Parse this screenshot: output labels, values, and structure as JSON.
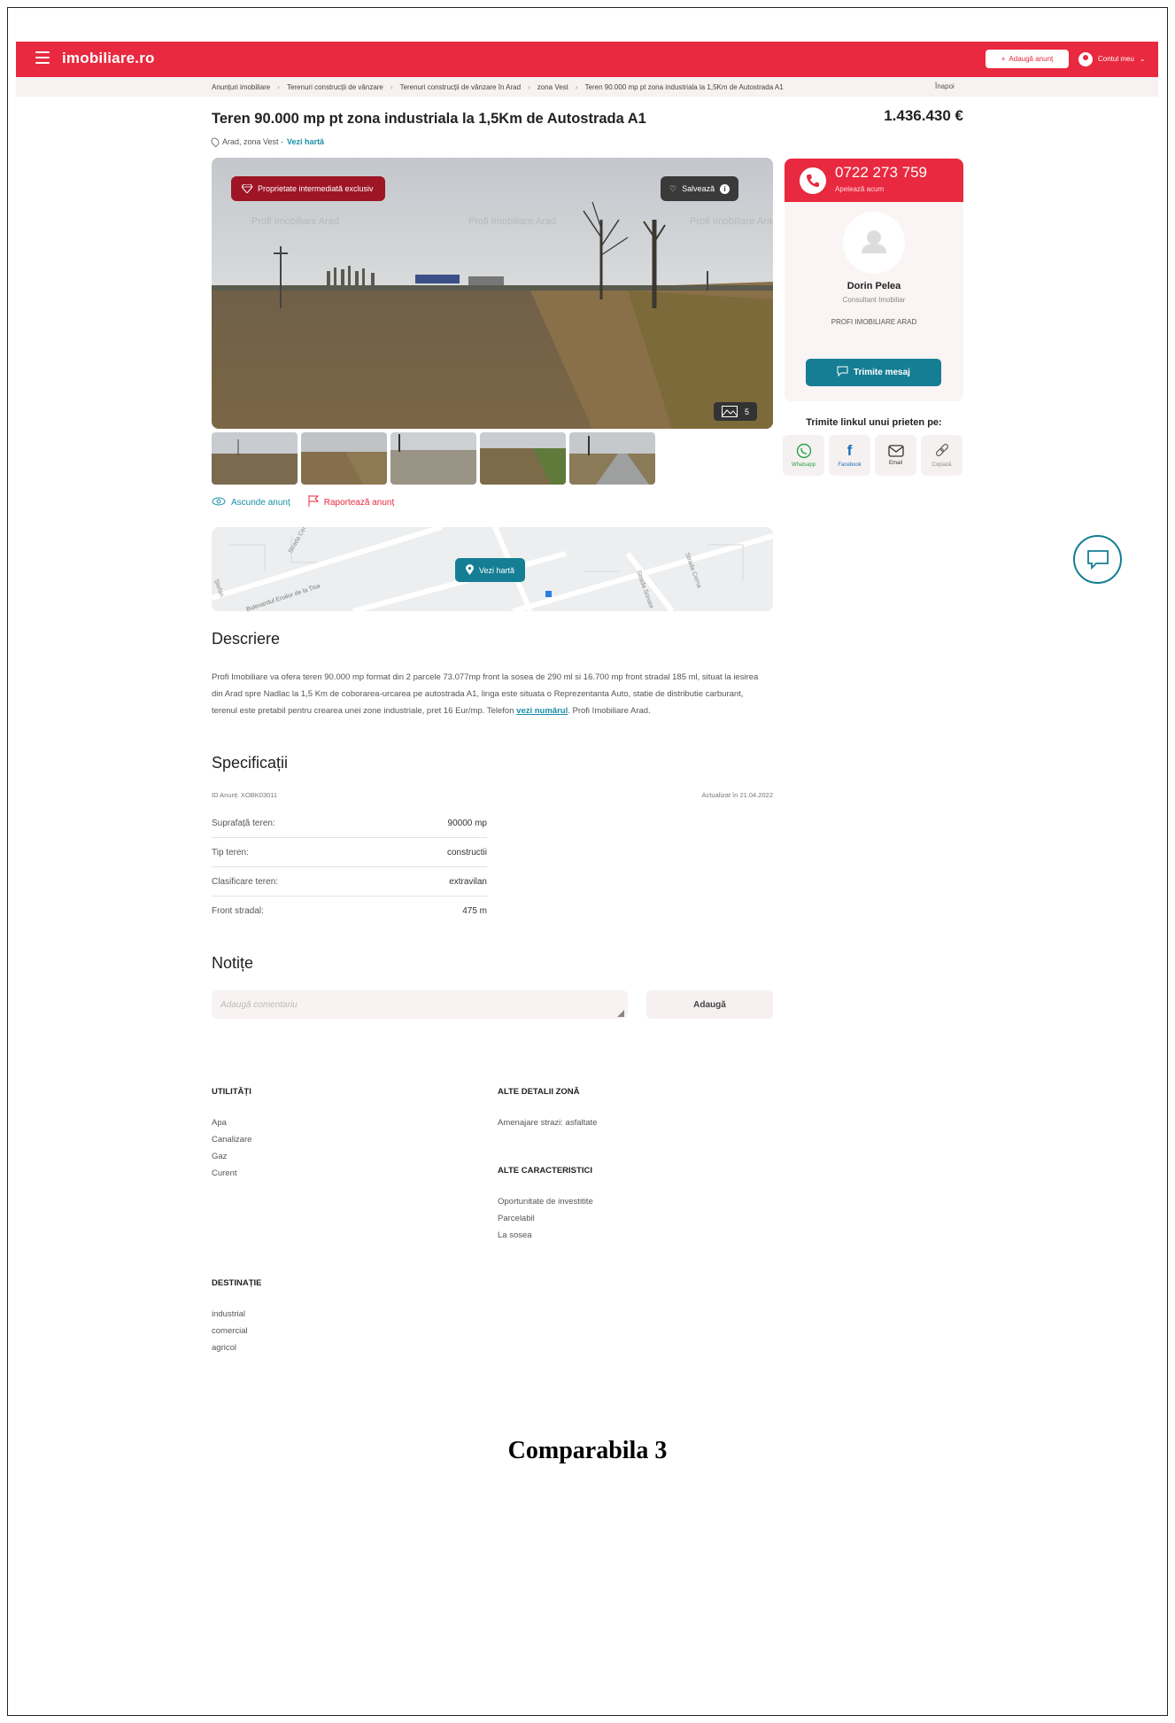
{
  "header": {
    "logo": "imobiliare.ro",
    "add_listing": "Adaugă anunț",
    "account": "Contul meu"
  },
  "breadcrumb": {
    "items": [
      "Anunțuri imobiliare",
      "Terenuri construcții de vânzare",
      "Terenuri construcții de vânzare în Arad",
      "zona Vest",
      "Teren 90.000 mp pt zona industriala la 1,5Km de Autostrada A1"
    ],
    "back": "Înapoi"
  },
  "listing": {
    "title": "Teren 90.000 mp pt zona industriala la 1,5Km de Autostrada A1",
    "price": "1.436.430 €",
    "location": "Arad, zona Vest -",
    "map_link": "Vezi hartă"
  },
  "gallery": {
    "exclusive_badge": "Proprietate intermediată exclusiv",
    "save_label": "Salvează",
    "save_info": "i",
    "photo_count": "5",
    "thumbnail_count": 5,
    "watermark": "Profi Imobiliare Arad"
  },
  "actions": {
    "hide": "Ascunde anunț",
    "report": "Raportează anunț"
  },
  "map": {
    "button": "Vezi hartă",
    "streets": [
      "Strada Cerna",
      "Bulevardul Eroilor de la Tisa",
      "Strada Sonata",
      "Strada Cerna",
      "Ștefan"
    ]
  },
  "contact": {
    "phone": "0722 273 759",
    "call_now": "Apelează acum",
    "agent_name": "Dorin Pelea",
    "agent_role": "Consultant Imobiliar",
    "agency": "PROFI IMOBILIARE ARAD",
    "message_button": "Trimite mesaj",
    "share_title": "Trimite linkul unui prieten pe:",
    "share": [
      {
        "label": "Whatsapp",
        "icon": "whatsapp-icon"
      },
      {
        "label": "Facebook",
        "icon": "facebook-icon"
      },
      {
        "label": "Email",
        "icon": "email-icon"
      },
      {
        "label": "Copiază",
        "icon": "link-icon"
      }
    ]
  },
  "description": {
    "heading": "Descriere",
    "text": "Profi Imobiliare va ofera teren 90.000 mp format din 2 parcele 73.077mp front la sosea de 290 ml si 16.700 mp front stradal 185 ml, situat la iesirea din Arad spre Nadlac la 1,5 Km de coborarea-urcarea pe autostrada A1, linga este situata o Reprezentanta Auto, statie de distributie carburant, terenul este pretabil pentru crearea unei zone industriale, pret 16 Eur/mp. Telefon",
    "phone_link": "vezi numărul",
    "text_end": ". Profi Imobiliare Arad."
  },
  "specs": {
    "heading": "Specificații",
    "id": "ID Anunț: XOBK03011",
    "updated": "Actualizat în 21.04.2022",
    "rows": [
      {
        "label": "Suprafață teren:",
        "value": "90000 mp"
      },
      {
        "label": "Tip teren:",
        "value": "constructii"
      },
      {
        "label": "Clasificare teren:",
        "value": "extravilan"
      },
      {
        "label": "Front stradal:",
        "value": "475 m"
      }
    ]
  },
  "notes": {
    "heading": "Notițe",
    "placeholder": "Adaugă comentariu",
    "add_button": "Adaugă"
  },
  "features": {
    "utilities_title": "UTILITĂȚI",
    "utilities": [
      "Apa",
      "Canalizare",
      "Gaz",
      "Curent"
    ],
    "zone_title": "ALTE DETALII ZONĂ",
    "zone": [
      "Amenajare strazi: asfaltate"
    ],
    "other_title": "ALTE CARACTERISTICI",
    "other": [
      "Oportunitate de investitite",
      "Parcelabil",
      "La sosea"
    ],
    "destination_title": "DESTINAȚIE",
    "destination": [
      "industrial",
      "comercial",
      "agricol"
    ]
  },
  "caption": "Comparabila 3",
  "colors": {
    "brand_red": "#e8293f",
    "exclusive_badge": "#9e1526",
    "teal": "#157e94"
  }
}
